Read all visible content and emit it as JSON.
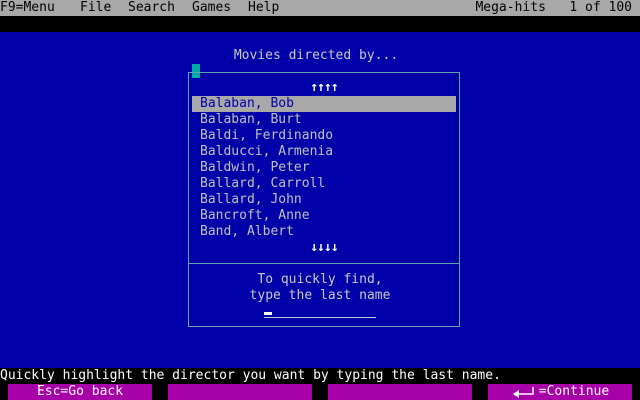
{
  "menubar": {
    "f9": "F9=Menu",
    "file": "File",
    "search": "Search",
    "games": "Games",
    "help": "Help",
    "right": "Mega-hits   1 of 100"
  },
  "dialog": {
    "title": "Movies directed by...",
    "scroll_up": "↑↑↑↑",
    "scroll_down": "↓↓↓↓",
    "directors": [
      "Balaban, Bob",
      "Balaban, Burt",
      "Baldi, Ferdinando",
      "Balducci, Armenia",
      "Baldwin, Peter",
      "Ballard, Carroll",
      "Ballard, John",
      "Bancroft, Anne",
      "Band, Albert"
    ],
    "selected_index": 0,
    "hint_line_1": "To quickly find,",
    "hint_line_2": "type the last name",
    "input_value": ""
  },
  "status": {
    "message": "Quickly highlight the director you want by typing the last name."
  },
  "footer": {
    "key1": "Esc=Go back",
    "key2": "",
    "key3": "",
    "key4_label": "=Continue",
    "key4_icon": "enter-icon"
  },
  "colors": {
    "background": "#0000a8",
    "menubar": "#a8a8a8",
    "selection": "#a8a8a8",
    "function_key": "#a800a8",
    "cursor": "#00a8a8"
  }
}
